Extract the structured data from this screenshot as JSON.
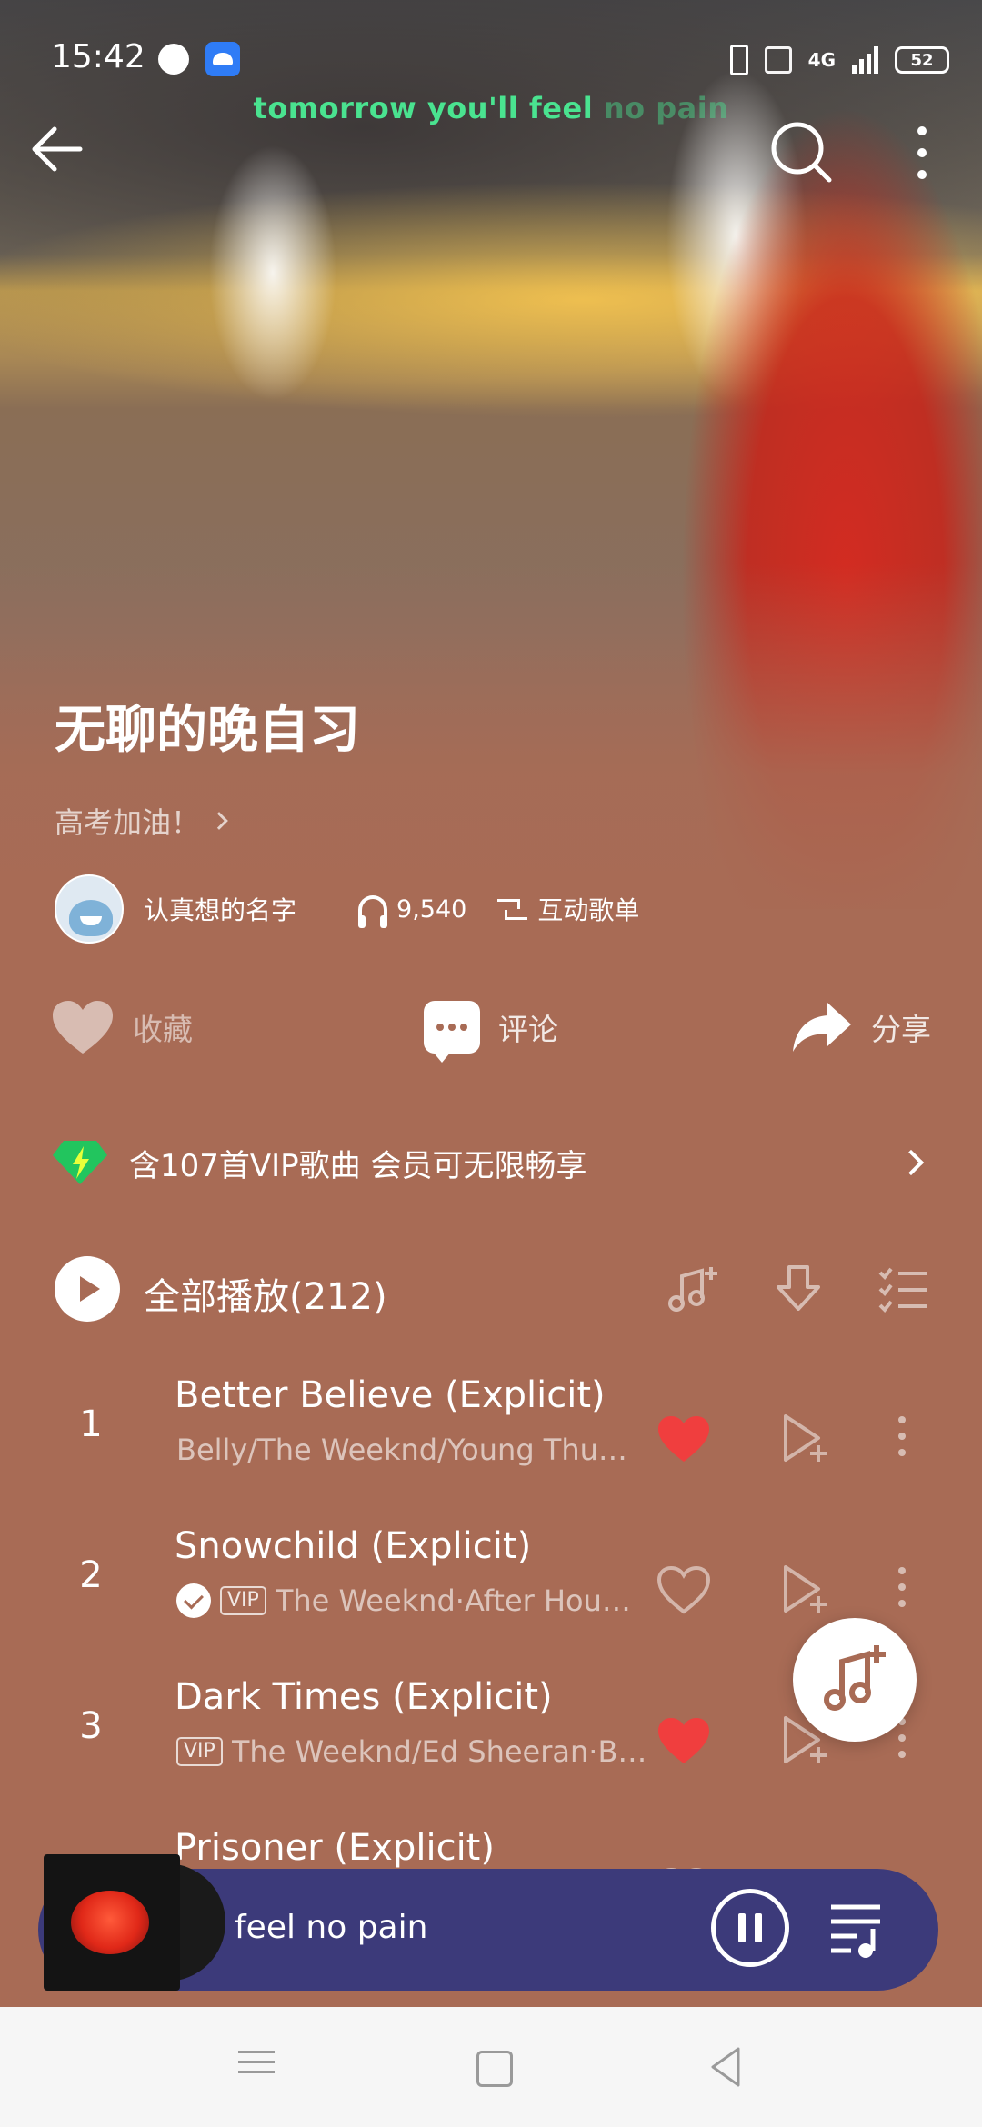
{
  "status_bar": {
    "time": "15:42",
    "network": "4G",
    "battery": "52"
  },
  "lyric": {
    "bright": "tomorrow you'll feel",
    "dim": " no pain"
  },
  "header": {
    "title": "无聊的晚自习",
    "description": "高考加油！",
    "creator_name": "认真想的名字",
    "play_count": "9,540",
    "interactive_label": "互动歌单"
  },
  "actions": {
    "collect_label": "收藏",
    "comment_label": "评论",
    "share_label": "分享"
  },
  "vip_banner": {
    "text": "含107首VIP歌曲 会员可无限畅享"
  },
  "play_all": {
    "label": "全部播放(212)"
  },
  "songs": [
    {
      "index": "1",
      "title": "Better Believe (Explicit)",
      "subtitle": "Belly/The Weeknd/Young Thu…",
      "liked": true,
      "badges": []
    },
    {
      "index": "2",
      "title": "Snowchild (Explicit)",
      "subtitle": "The Weeknd·After Hou…",
      "liked": false,
      "badges": [
        "check",
        "VIP"
      ]
    },
    {
      "index": "3",
      "title": "Dark Times (Explicit)",
      "subtitle": "The Weeknd/Ed Sheeran·B…",
      "liked": true,
      "badges": [
        "VIP"
      ]
    },
    {
      "index": "4",
      "title": "Prisoner (Explicit)",
      "subtitle": "",
      "liked": false,
      "badges": []
    }
  ],
  "mini_player": {
    "title": "feel no pain",
    "state": "playing"
  },
  "colors": {
    "background": "#a86b55",
    "lyric_green": "#4ae390",
    "like_red": "#f03e3e",
    "mini_player": "#3c3a7a",
    "vip_gem": "#22c55e"
  }
}
